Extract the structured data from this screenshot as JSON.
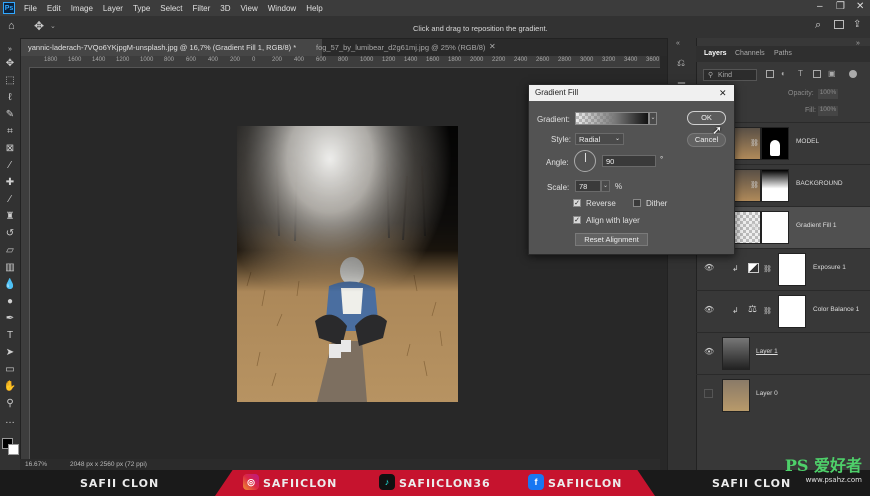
{
  "app": {
    "logo": "Ps",
    "menu": [
      "File",
      "Edit",
      "Image",
      "Layer",
      "Type",
      "Select",
      "Filter",
      "3D",
      "View",
      "Window",
      "Help"
    ]
  },
  "options_bar": {
    "hint": "Click and drag to reposition the gradient."
  },
  "tabs": [
    {
      "label": "yannic-laderach-7VQo6YKjpgM-unsplash.jpg @ 16,7% (Gradient Fill 1, RGB/8) *",
      "active": true
    },
    {
      "label": "fog_57_by_lumibear_d2g61mj.jpg @ 25% (RGB/8)",
      "active": false
    }
  ],
  "ruler": {
    "ticks": [
      "1800",
      "1600",
      "1400",
      "1200",
      "1000",
      "800",
      "600",
      "400",
      "200",
      "0",
      "200",
      "400",
      "600",
      "800",
      "1000",
      "1200",
      "1400",
      "1600",
      "1800",
      "2000",
      "2200",
      "2400",
      "2600",
      "2800",
      "3000",
      "3200",
      "3400",
      "3600",
      "3800"
    ]
  },
  "status": {
    "zoom": "16.67%",
    "doc_info": "2048 px x 2560 px (72 ppi)"
  },
  "panel": {
    "tabs": [
      "Layers",
      "Channels",
      "Paths"
    ],
    "kind_label": "Kind",
    "opacity_label": "Opacity:",
    "opacity_value": "100%",
    "fill_label": "Fill:",
    "fill_value": "100%",
    "layers": [
      {
        "name": "MODEL"
      },
      {
        "name": "BACKGROUND"
      },
      {
        "name": "Gradient Fill 1"
      },
      {
        "name": "Exposure 1"
      },
      {
        "name": "Color Balance 1"
      },
      {
        "name": "Layer 1"
      },
      {
        "name": "Layer 0"
      }
    ]
  },
  "dialog": {
    "title": "Gradient Fill",
    "close": "✕",
    "gradient_label": "Gradient:",
    "style_label": "Style:",
    "style_value": "Radial",
    "angle_label": "Angle:",
    "angle_value": "90",
    "angle_unit": "°",
    "scale_label": "Scale:",
    "scale_value": "78",
    "scale_unit": "%",
    "reverse_label": "Reverse",
    "reverse_checked": true,
    "dither_label": "Dither",
    "dither_checked": false,
    "align_label": "Align with layer",
    "align_checked": true,
    "reset_label": "Reset Alignment",
    "ok_label": "OK",
    "cancel_label": "Cancel"
  },
  "banner": {
    "left_name": "SAFII CLON",
    "instagram": "SAFIICLON",
    "tiktok": "SAFIICLON36",
    "facebook": "SAFIICLON",
    "right_name": "SAFII CLON"
  },
  "watermark": {
    "main": "PS 爱好者",
    "sub": "www.psahz.com"
  },
  "colors": {
    "banner_red": "#c6132e",
    "accent_blue": "#31a8ff",
    "watermark_green": "#4ed06a"
  }
}
